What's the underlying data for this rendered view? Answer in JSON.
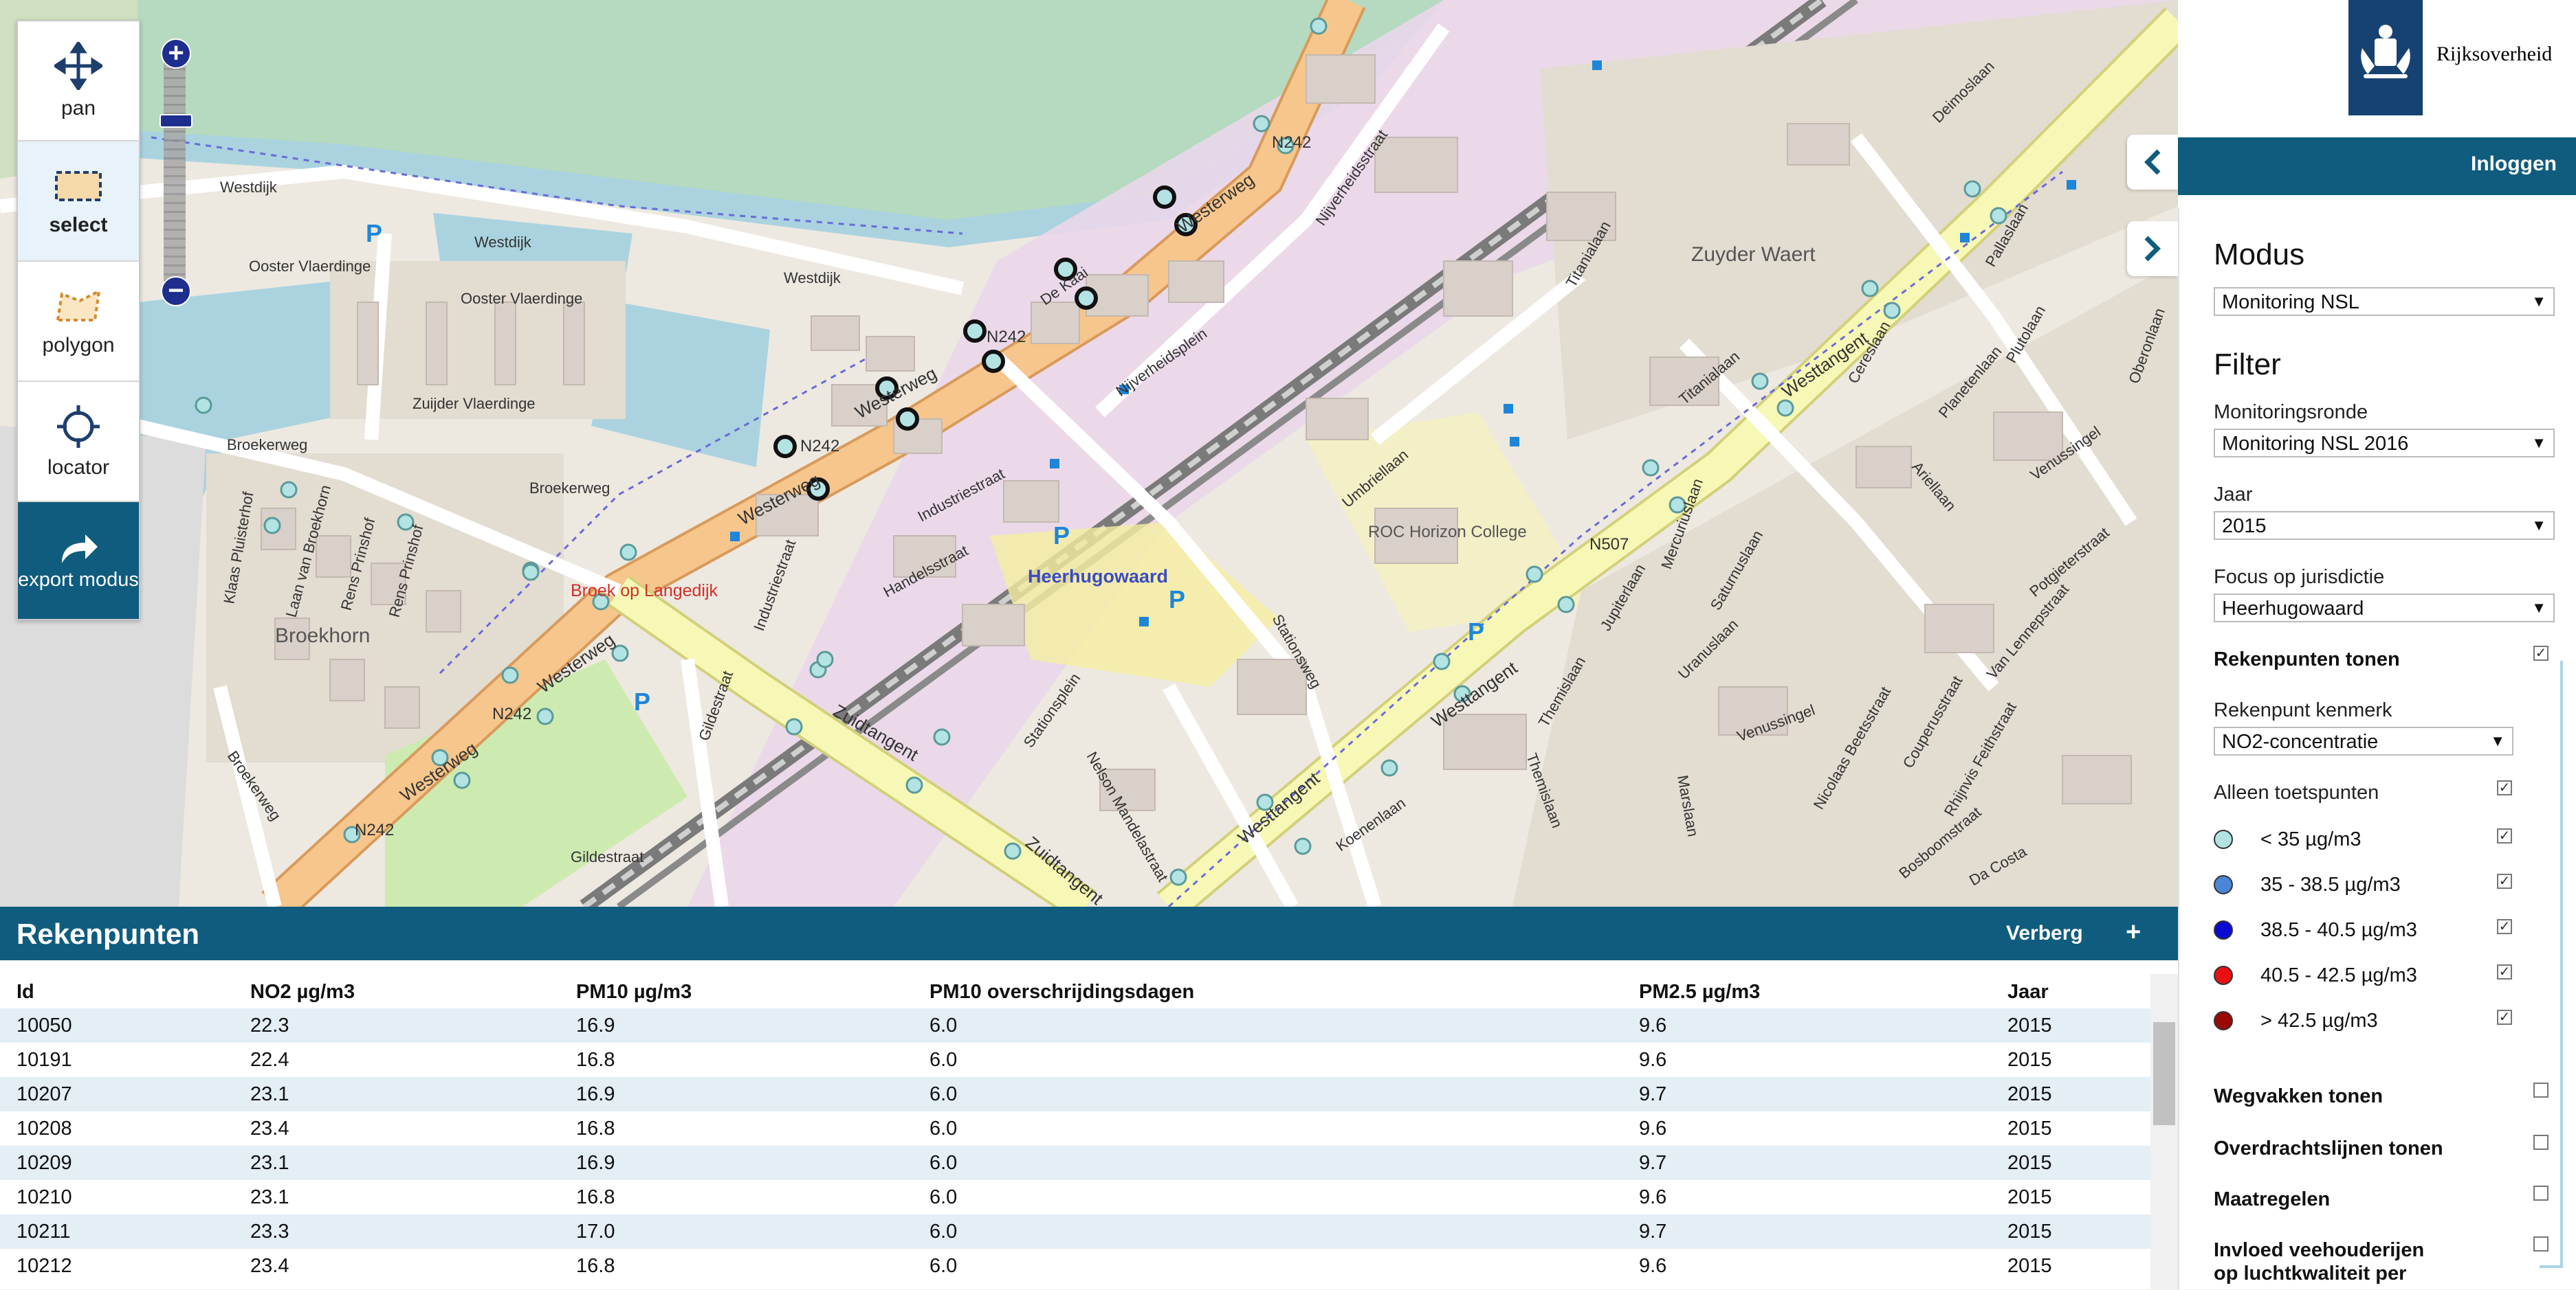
{
  "tools": {
    "pan": "pan",
    "select": "select",
    "polygon": "polygon",
    "locator": "locator",
    "export": "export modus"
  },
  "zoom": {
    "plus": "+",
    "minus": "−"
  },
  "map_labels": {
    "westdijk_1": "Westdijk",
    "westdijk_2": "Westdijk",
    "westdijk_3": "Westdijk",
    "ooster_vlaerdinge_1": "Ooster Vlaerdinge",
    "ooster_vlaerdinge_2": "Ooster Vlaerdinge",
    "zuijder_vlaerdinge": "Zuijder Vlaerdinge",
    "broekerweg_1": "Broekerweg",
    "broekerweg_2": "Broekerweg",
    "broekerweg_3": "Broekerweg",
    "broek_op_langedijk": "Broek op Langedijk",
    "broekhorn": "Broekhorn",
    "westerweg_1": "Westerweg",
    "westerweg_2": "Westerweg",
    "westerweg_3": "Westerweg",
    "westerweg_4": "Westerweg",
    "westerweg_5": "Westerweg",
    "n242_1": "N242",
    "n242_2": "N242",
    "n242_3": "N242",
    "n242_4": "N242",
    "n242_5": "N242",
    "n507": "N507",
    "nijverheidsstraat": "Nijverheidsstraat",
    "nijverheidsplein": "Nijverheidsplein",
    "industriestraat_1": "Industriestraat",
    "industriestraat_2": "Industriestraat",
    "heerhugowaard": "Heerhugowaard",
    "handelsstraat": "Handelsstraat",
    "zuidtangent_1": "Zuidtangent",
    "zuidtangent_2": "Zuidtangent",
    "stationsplein": "Stationsplein",
    "stationsweg": "Stationsweg",
    "nelson_mandelastraat": "Nelson Mandelastraat",
    "umbriellaan": "Umbriellaan",
    "roc": "ROC Horizon College",
    "westtangent_1": "Westtangent",
    "westtangent_2": "Westtangent",
    "westtangent_3": "Westtangent",
    "zuyder_waert": "Zuyder Waert",
    "titanialaan_1": "Titanialaan",
    "titanialaan_2": "Titanialaan",
    "demoslaan": "Deimoslaan",
    "ceresplein": "Cereslaan",
    "plutolaan": "Plutolaan",
    "oberonlaan": "Oberonlaan",
    "arielaan": "Ariellaan",
    "venussingel_1": "Venussingel",
    "venussingel_2": "Venussingel",
    "mercuriuslaan": "Mercuriuslaan",
    "jupiterlaan": "Jupiterlaan",
    "uranuslaan": "Uranuslaan",
    "saturnuslaan": "Saturnuslaan",
    "themislaan_1": "Themislaan",
    "themislaan_2": "Themislaan",
    "marslaan": "Marslaan",
    "nicolaas_beetsstraat": "Nicolaas Beetsstraat",
    "couperusstraat": "Couperusstraat",
    "potgieterstraat": "Potgieterstraat",
    "van_lennepstraat": "Van Lennepstraat",
    "rhijnvis_feithstraat": "Rhijnvis Feithstraat",
    "bosboomstraat": "Bosboomstraat",
    "da_costa": "Da Costa",
    "koenenlaan": "Koenenlaan",
    "gildestraat_1": "Gildestraat",
    "gildestraat_2": "Gildestraat",
    "laan_van_broekhorn": "Laan van Broekhorn",
    "rens_prinshof_1": "Rens Prinshof",
    "rens_prinshof_2": "Rens Prinshof",
    "klaas_pluisterhof": "Klaas Pluisterhof",
    "de_kaai": "De Kaai",
    "pallaslaan": "Pallaslaan",
    "planetenlaan": "Planetenlaan",
    "p": "P"
  },
  "side": {
    "logo_name": "Rijksoverheid",
    "login": "Inloggen",
    "modus_heading": "Modus",
    "modus_value": "Monitoring NSL",
    "filter_heading": "Filter",
    "monitoringsronde_label": "Monitoringsronde",
    "monitoringsronde_value": "Monitoring NSL 2016",
    "jaar_label": "Jaar",
    "jaar_value": "2015",
    "focus_label": "Focus op jurisdictie",
    "focus_value": "Heerhugowaard",
    "rekenpunten_tonen": "Rekenpunten tonen",
    "kenmerk_label": "Rekenpunt kenmerk",
    "kenmerk_value": "NO2-concentratie",
    "alleen_toetspunten": "Alleen toetspunten",
    "legend": [
      {
        "label": "< 35 µg/m3",
        "color": "#b4e3e3"
      },
      {
        "label": "35 - 38.5 µg/m3",
        "color": "#4a86d8"
      },
      {
        "label": "38.5 - 40.5 µg/m3",
        "color": "#0a0ad2"
      },
      {
        "label": "40.5 - 42.5 µg/m3",
        "color": "#e81010"
      },
      {
        "label": "> 42.5 µg/m3",
        "color": "#9a0808"
      }
    ],
    "wegvakken": "Wegvakken tonen",
    "overdracht": "Overdrachtslijnen tonen",
    "maatregelen": "Maatregelen",
    "invloed_1": "Invloed veehouderijen",
    "invloed_2": "op luchtkwaliteit per"
  },
  "table": {
    "title": "Rekenpunten",
    "hide": "Verberg",
    "plus": "+",
    "columns": [
      "Id",
      "NO2 µg/m3",
      "PM10 µg/m3",
      "PM10 overschrijdingsdagen",
      "PM2.5 µg/m3",
      "Jaar"
    ],
    "rows": [
      [
        "10050",
        "22.3",
        "16.9",
        "6.0",
        "9.6",
        "2015"
      ],
      [
        "10191",
        "22.4",
        "16.8",
        "6.0",
        "9.6",
        "2015"
      ],
      [
        "10207",
        "23.1",
        "16.9",
        "6.0",
        "9.7",
        "2015"
      ],
      [
        "10208",
        "23.4",
        "16.8",
        "6.0",
        "9.6",
        "2015"
      ],
      [
        "10209",
        "23.1",
        "16.9",
        "6.0",
        "9.7",
        "2015"
      ],
      [
        "10210",
        "23.1",
        "16.8",
        "6.0",
        "9.6",
        "2015"
      ],
      [
        "10211",
        "23.3",
        "17.0",
        "6.0",
        "9.7",
        "2015"
      ],
      [
        "10212",
        "23.4",
        "16.8",
        "6.0",
        "9.6",
        "2015"
      ]
    ]
  },
  "colors": {
    "brand": "#0f5c7e",
    "water": "#aad3df",
    "road_primary": "#f6c68c",
    "road_secondary": "#f7f8b5",
    "industrial": "#ead7ea",
    "row_highlight": "#e4eef5"
  }
}
